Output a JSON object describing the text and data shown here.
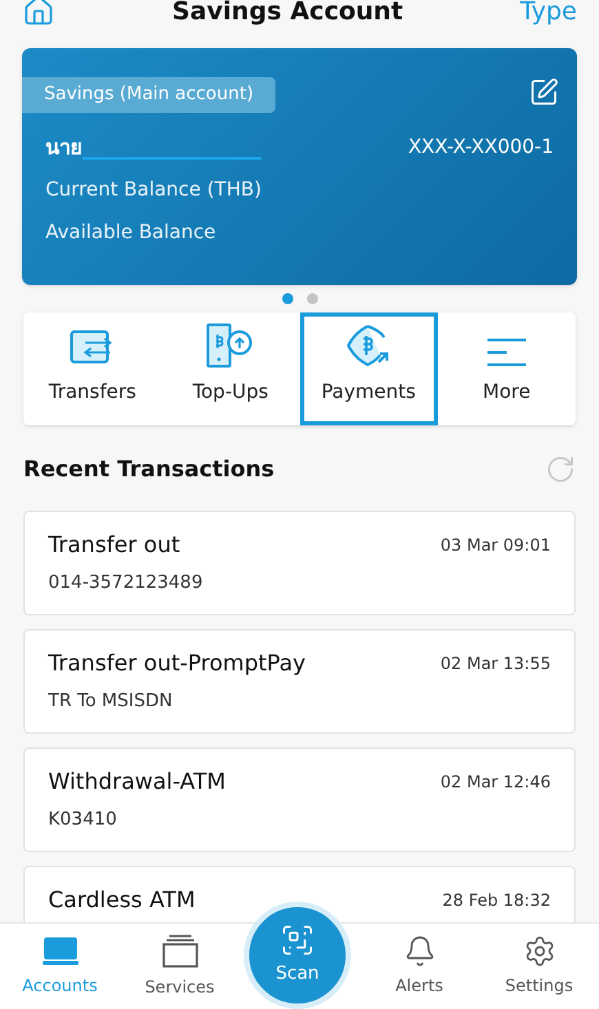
{
  "header": {
    "title": "Savings Account",
    "action": "Type"
  },
  "account_card": {
    "tag": "Savings (Main account)",
    "name_prefix": "นาย",
    "account_number": "XXX-X-XX000-1",
    "lines": [
      "Current Balance (THB)",
      "Available Balance"
    ]
  },
  "pager": [
    {
      "selected": true
    },
    {
      "selected": false
    }
  ],
  "actions": [
    {
      "kind": "transfers",
      "label": "Transfers",
      "selected": false
    },
    {
      "kind": "topups",
      "label": "Top-Ups",
      "selected": false
    },
    {
      "kind": "payments",
      "label": "Payments",
      "selected": true
    },
    {
      "kind": "more",
      "label": "More",
      "selected": false
    }
  ],
  "recent": {
    "title": "Recent Transactions"
  },
  "transactions": [
    {
      "title": "Transfer out",
      "detail": "014-3572123489",
      "time": "03 Mar 09:01"
    },
    {
      "title": "Transfer out-PromptPay",
      "detail": "TR To MSISDN",
      "time": "02 Mar 13:55"
    },
    {
      "title": "Withdrawal-ATM",
      "detail": "K03410",
      "time": "02 Mar 12:46"
    },
    {
      "title": "Cardless ATM",
      "time": "28 Feb 18:32"
    }
  ],
  "nav": [
    {
      "kind": "accounts",
      "label": "Accounts",
      "selected": true
    },
    {
      "kind": "services",
      "label": "Services",
      "selected": false
    },
    {
      "kind": "scan",
      "label": "Scan",
      "selected": false
    },
    {
      "kind": "alerts",
      "label": "Alerts",
      "selected": false
    },
    {
      "kind": "settings",
      "label": "Settings",
      "selected": false
    }
  ]
}
